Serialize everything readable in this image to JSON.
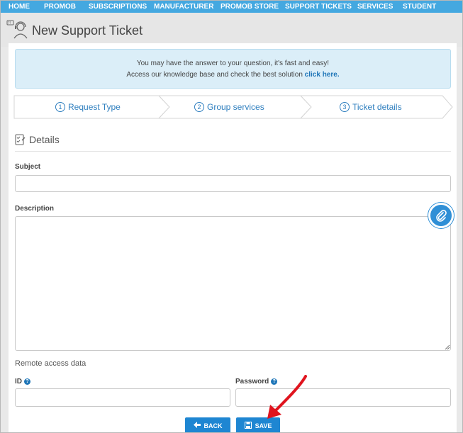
{
  "nav": {
    "items": [
      "HOME",
      "PROMOB",
      "SUBSCRIPTIONS",
      "MANUFACTURER",
      "PROMOB STORE",
      "SUPPORT TICKETS",
      "SERVICES",
      "STUDENT"
    ]
  },
  "header": {
    "title": "New Support Ticket"
  },
  "info": {
    "line1": "You may have the answer to your question, it's fast and easy!",
    "line2": "Access our knowledge base and check the best solution",
    "link": "click here."
  },
  "steps": [
    {
      "num": "1",
      "label": "Request Type"
    },
    {
      "num": "2",
      "label": "Group services"
    },
    {
      "num": "3",
      "label": "Ticket details"
    }
  ],
  "details": {
    "heading": "Details"
  },
  "form": {
    "subject_label": "Subject",
    "subject_value": "",
    "description_label": "Description",
    "description_value": "",
    "remote_label": "Remote access data",
    "id_label": "ID",
    "id_value": "",
    "password_label": "Password",
    "password_value": ""
  },
  "buttons": {
    "back": "BACK",
    "save": "SAVE"
  },
  "colors": {
    "nav": "#44a8e0",
    "accent": "#1e86d2",
    "annotation_arrow": "#e0141e"
  }
}
